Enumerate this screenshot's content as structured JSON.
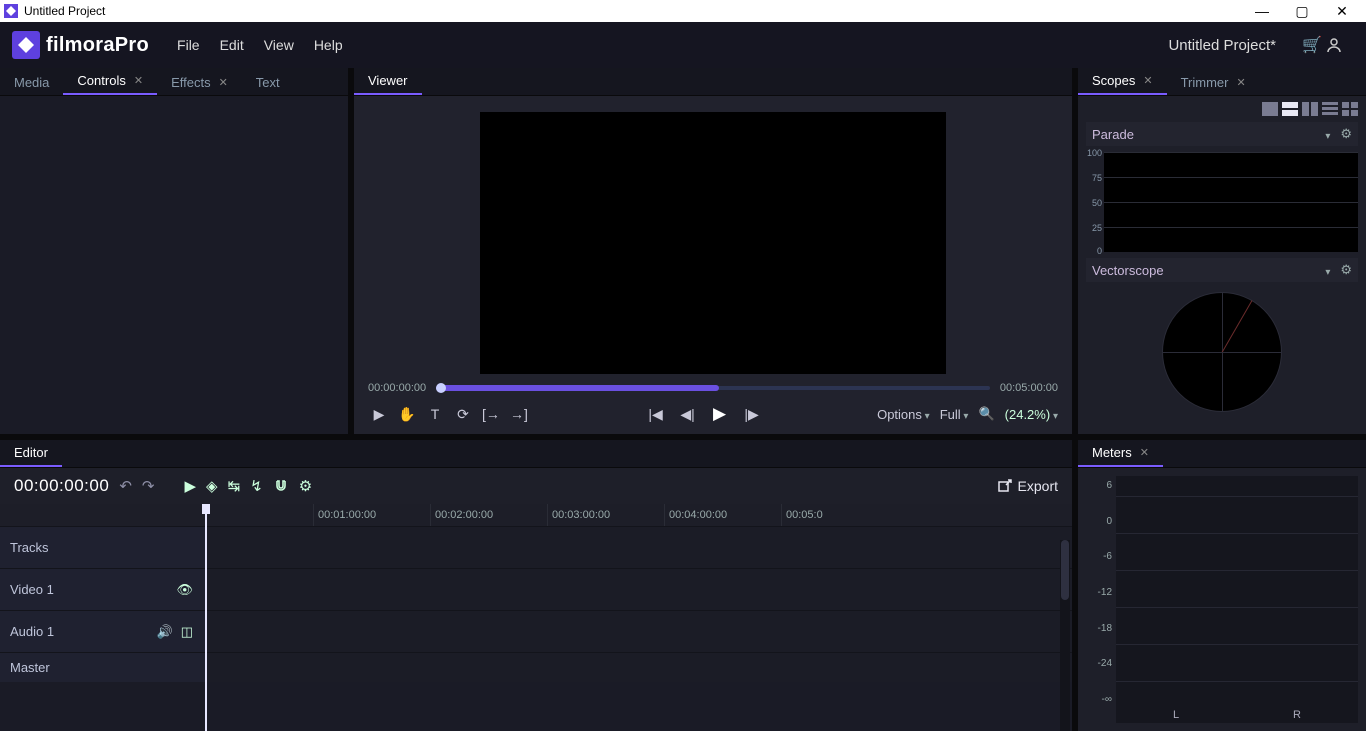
{
  "window": {
    "title": "Untitled Project"
  },
  "brand": {
    "name_a": "filmora",
    "name_b": "Pro"
  },
  "menu": {
    "file": "File",
    "edit": "Edit",
    "view": "View",
    "help": "Help"
  },
  "project_title": "Untitled Project*",
  "left_tabs": {
    "media": "Media",
    "controls": "Controls",
    "effects": "Effects",
    "text": "Text"
  },
  "viewer": {
    "tab": "Viewer",
    "tc_left": "00:00:00:00",
    "tc_right": "00:05:00:00",
    "options": "Options",
    "full": "Full",
    "zoom": "(24.2%)"
  },
  "scopes": {
    "tab_scopes": "Scopes",
    "tab_trimmer": "Trimmer",
    "parade": "Parade",
    "vectorscope": "Vectorscope",
    "parade_ticks": [
      "100",
      "75",
      "50",
      "25",
      "0"
    ]
  },
  "editor": {
    "tab": "Editor",
    "tc": "00:00:00:00",
    "export": "Export",
    "tracks_header": "Tracks",
    "video1": "Video 1",
    "audio1": "Audio 1",
    "master": "Master",
    "ruler": [
      "00:01:00:00",
      "00:02:00:00",
      "00:03:00:00",
      "00:04:00:00",
      "00:05:0"
    ]
  },
  "meters": {
    "tab": "Meters",
    "scale": [
      "6",
      "0",
      "-6",
      "-12",
      "-18",
      "-24",
      "-∞"
    ],
    "L": "L",
    "R": "R"
  }
}
